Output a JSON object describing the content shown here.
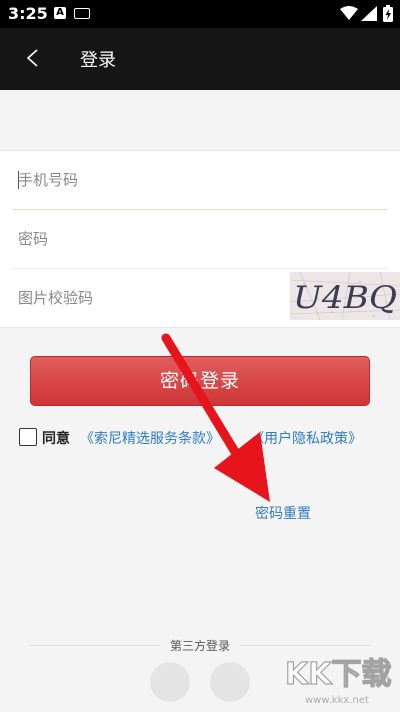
{
  "status_bar": {
    "time": "3:25",
    "icons": [
      "notification-a-icon",
      "keyboard-icon",
      "wifi-icon",
      "signal-icon",
      "battery-icon"
    ]
  },
  "app_bar": {
    "back_icon": "chevron-left-icon",
    "title": "登录"
  },
  "form": {
    "phone_placeholder": "手机号码",
    "password_placeholder": "密码",
    "captcha_placeholder": "图片校验码",
    "captcha_text": "U4BQ"
  },
  "login_button": "密码登录",
  "agreement": {
    "label": "同意",
    "terms_link": "《索尼精选服务条款》",
    "privacy_link": "《用户隐私政策》"
  },
  "reset_link": "密码重置",
  "third_party": {
    "label": "第三方登录"
  },
  "watermark": {
    "logo_text": "KK下载",
    "url": "www.kkx.net"
  },
  "colors": {
    "accent_red": "#d63b3b",
    "link_blue": "#2f7cc4",
    "app_bar": "#161616",
    "annotation_arrow": "#e8141b"
  }
}
